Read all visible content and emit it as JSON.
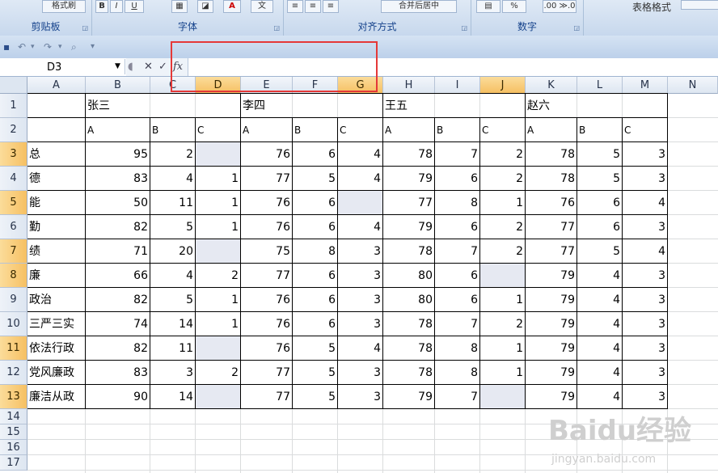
{
  "ribbon": {
    "groups": [
      {
        "label": "剪贴板"
      },
      {
        "label": "字体"
      },
      {
        "label": "对齐方式"
      },
      {
        "label": "数字"
      },
      {
        "label": "表格格式"
      }
    ],
    "clipboard_button": "格式刷",
    "bold": "B",
    "italic": "I",
    "underline": "U",
    "percent": "%",
    "decimals": ".00 ≫.0",
    "merge_center": "合并后居中"
  },
  "formula_bar": {
    "name_box": "D3",
    "cancel_symbol": "✕",
    "enter_symbol": "✓",
    "fx_symbol": "fx",
    "value": ""
  },
  "columns": [
    "A",
    "B",
    "C",
    "D",
    "E",
    "F",
    "G",
    "H",
    "I",
    "J",
    "K",
    "L",
    "M",
    "N"
  ],
  "selected_columns": [
    "D",
    "G",
    "J"
  ],
  "rows": [
    "1",
    "2",
    "3",
    "4",
    "5",
    "6",
    "7",
    "8",
    "9",
    "10",
    "11",
    "12",
    "13",
    "14",
    "15",
    "16",
    "17"
  ],
  "selected_rows": [
    "3",
    "5",
    "7",
    "8",
    "11",
    "13"
  ],
  "header_row1": {
    "b": "张三",
    "e": "李四",
    "h": "王五",
    "k": "赵六"
  },
  "header_row2": [
    "A",
    "B",
    "C",
    "A",
    "B",
    "C",
    "A",
    "B",
    "C",
    "A",
    "B",
    "C"
  ],
  "data_rows": [
    {
      "label": "总",
      "values": [
        "95",
        "2",
        "",
        "76",
        "6",
        "4",
        "78",
        "7",
        "2",
        "78",
        "5",
        "3"
      ]
    },
    {
      "label": "德",
      "values": [
        "83",
        "4",
        "1",
        "77",
        "5",
        "4",
        "79",
        "6",
        "2",
        "78",
        "5",
        "3"
      ]
    },
    {
      "label": "能",
      "values": [
        "50",
        "11",
        "1",
        "76",
        "6",
        "",
        "77",
        "8",
        "1",
        "76",
        "6",
        "4"
      ]
    },
    {
      "label": "勤",
      "values": [
        "82",
        "5",
        "1",
        "76",
        "6",
        "4",
        "79",
        "6",
        "2",
        "77",
        "6",
        "3"
      ]
    },
    {
      "label": "绩",
      "values": [
        "71",
        "20",
        "",
        "75",
        "8",
        "3",
        "78",
        "7",
        "2",
        "77",
        "5",
        "4"
      ]
    },
    {
      "label": "廉",
      "values": [
        "66",
        "4",
        "2",
        "77",
        "6",
        "3",
        "80",
        "6",
        "",
        "79",
        "4",
        "3"
      ]
    },
    {
      "label": "政治",
      "values": [
        "82",
        "5",
        "1",
        "76",
        "6",
        "3",
        "80",
        "6",
        "1",
        "79",
        "4",
        "3"
      ]
    },
    {
      "label": "三严三实",
      "values": [
        "74",
        "14",
        "1",
        "76",
        "6",
        "3",
        "78",
        "7",
        "2",
        "79",
        "4",
        "3"
      ]
    },
    {
      "label": "依法行政",
      "values": [
        "82",
        "11",
        "",
        "76",
        "5",
        "4",
        "78",
        "8",
        "1",
        "79",
        "4",
        "3"
      ]
    },
    {
      "label": "党风廉政",
      "values": [
        "83",
        "3",
        "2",
        "77",
        "5",
        "3",
        "78",
        "8",
        "1",
        "79",
        "4",
        "3"
      ]
    },
    {
      "label": "廉洁从政",
      "values": [
        "90",
        "14",
        "",
        "77",
        "5",
        "3",
        "79",
        "7",
        "",
        "79",
        "4",
        "3"
      ]
    }
  ],
  "watermark": {
    "brand": "Baidu经验",
    "url": "jingyan.baidu.com"
  },
  "colors": {
    "highlight": "#e53838",
    "selected_header": "#f6c063",
    "empty_cell": "#e6e9f2"
  }
}
